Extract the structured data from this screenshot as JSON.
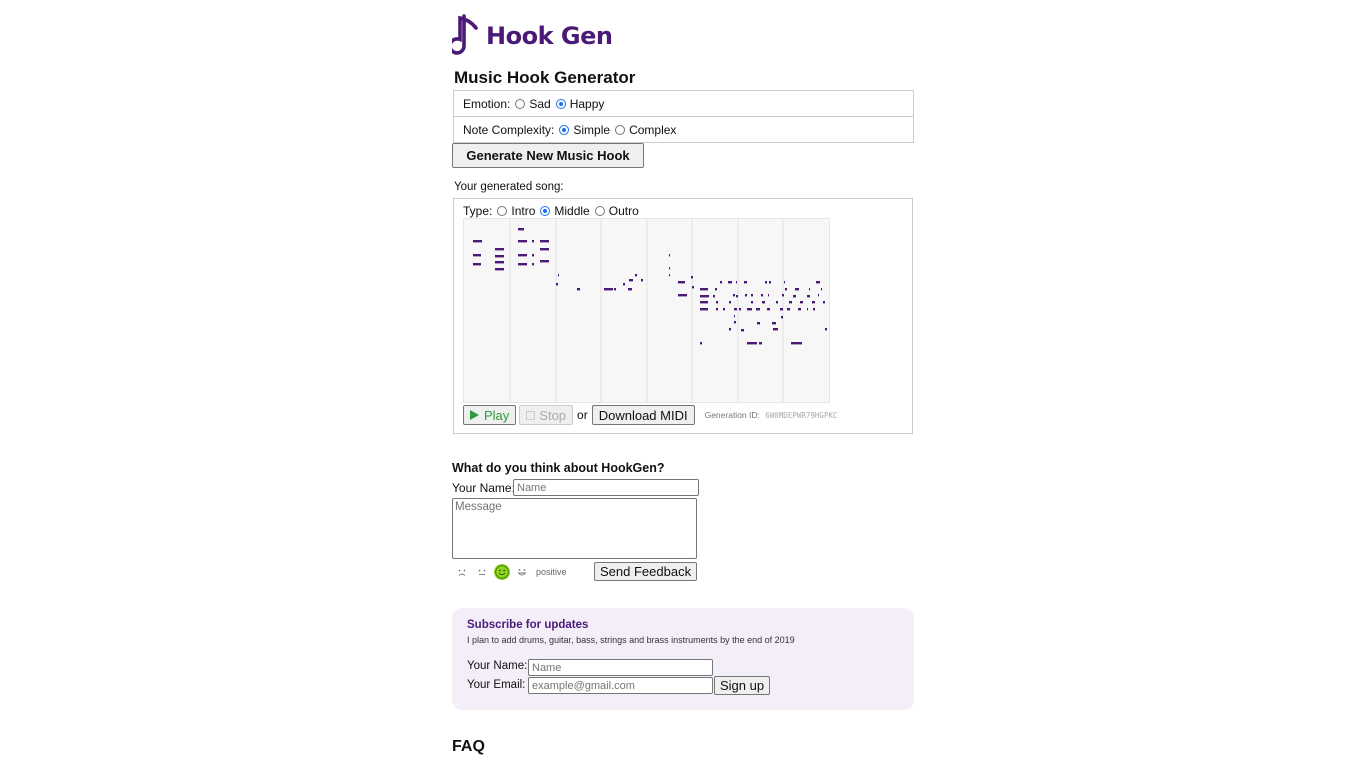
{
  "brand": {
    "name": "Hook Gen",
    "color": "#4b1a78"
  },
  "page_title": "Music Hook Generator",
  "emotion": {
    "label": "Emotion:",
    "options": [
      {
        "label": "Sad",
        "selected": false
      },
      {
        "label": "Happy",
        "selected": true
      }
    ]
  },
  "complexity": {
    "label": "Note Complexity:",
    "options": [
      {
        "label": "Simple",
        "selected": true
      },
      {
        "label": "Complex",
        "selected": false
      }
    ]
  },
  "generate_button": "Generate New Music Hook",
  "song": {
    "label": "Your generated song:",
    "type_label": "Type:",
    "types": [
      {
        "label": "Intro",
        "selected": false
      },
      {
        "label": "Middle",
        "selected": true
      },
      {
        "label": "Outro",
        "selected": false
      }
    ],
    "note_color": "#4b1a78"
  },
  "controls": {
    "play": "Play",
    "stop": "Stop",
    "or": "or",
    "download": "Download MIDI",
    "generation_label": "Generation ID:",
    "generation_id": "6W0MDEPWR79HGPKC"
  },
  "feedback": {
    "title": "What do you think about HookGen?",
    "name_label": "Your Name:",
    "name_placeholder": "Name",
    "message_placeholder": "Message",
    "sentiment": "positive",
    "sentiment_icons": [
      "very-sad-face-icon",
      "neutral-face-icon",
      "happy-face-icon",
      "very-happy-face-icon"
    ],
    "selected_sentiment_index": 2,
    "send": "Send Feedback"
  },
  "subscribe": {
    "title": "Subscribe for updates",
    "desc": "I plan to add drums, guitar, bass, strings and brass instruments by the end of 2019",
    "name_label": "Your Name:",
    "name_placeholder": "Name",
    "email_label": "Your Email:",
    "email_placeholder": "example@gmail.com",
    "signup": "Sign up"
  },
  "faq_heading": "FAQ"
}
